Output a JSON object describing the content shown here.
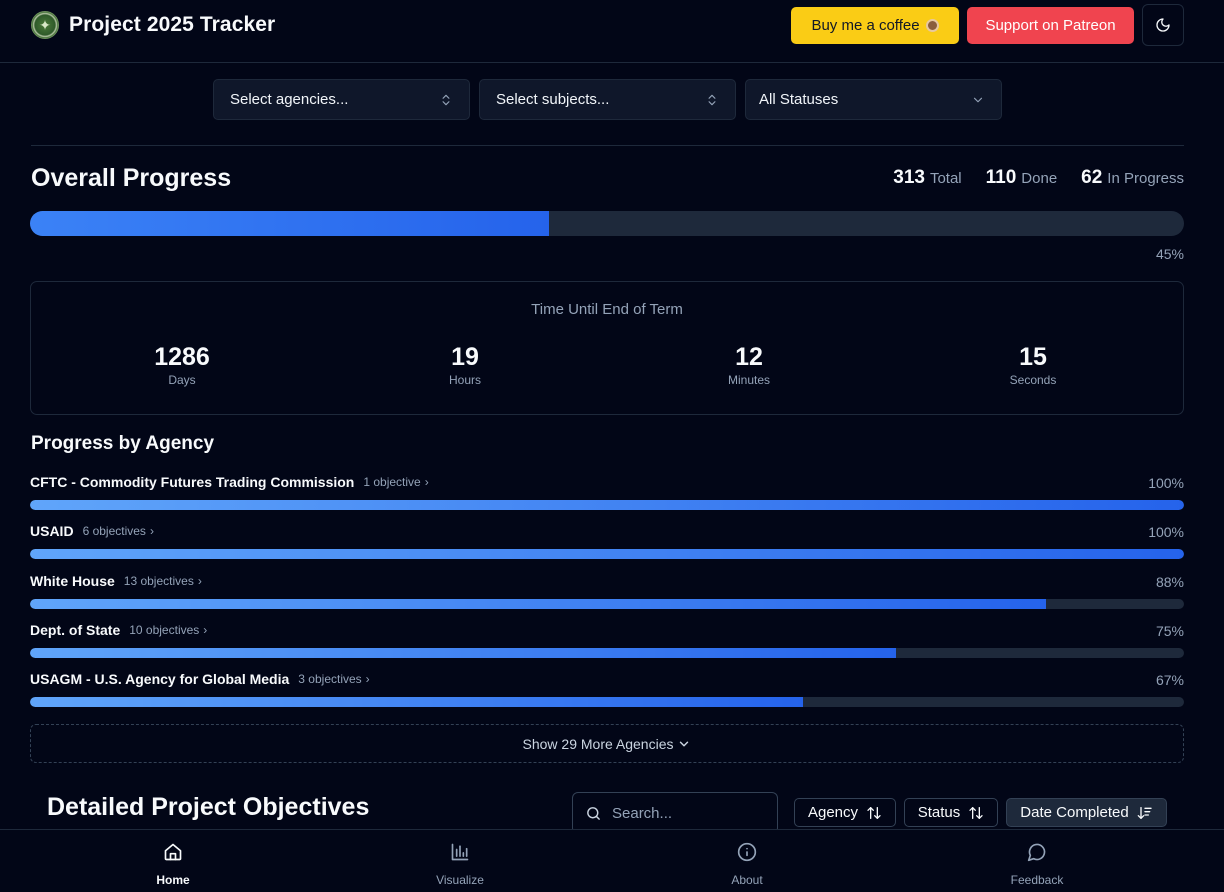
{
  "header": {
    "title": "Project 2025 Tracker",
    "coffee_label": "Buy me a coffee",
    "patreon_label": "Support on Patreon",
    "theme_icon": "moon-icon"
  },
  "filters": {
    "agencies_placeholder": "Select agencies...",
    "subjects_placeholder": "Select subjects...",
    "status_value": "All Statuses"
  },
  "overall": {
    "title": "Overall Progress",
    "total_num": "313",
    "total_label": "Total",
    "done_num": "110",
    "done_label": "Done",
    "progress_num": "62",
    "progress_label": "In Progress",
    "percent": 45,
    "percent_label": "45%"
  },
  "countdown": {
    "title": "Time Until End of Term",
    "units": [
      {
        "value": "1286",
        "label": "Days"
      },
      {
        "value": "19",
        "label": "Hours"
      },
      {
        "value": "12",
        "label": "Minutes"
      },
      {
        "value": "15",
        "label": "Seconds"
      }
    ]
  },
  "agencies": {
    "title": "Progress by Agency",
    "items": [
      {
        "name": "CFTC - Commodity Futures Trading Commission",
        "count": "1 objective",
        "percent": 100,
        "percent_label": "100%"
      },
      {
        "name": "USAID",
        "count": "6 objectives",
        "percent": 100,
        "percent_label": "100%"
      },
      {
        "name": "White House",
        "count": "13 objectives",
        "percent": 88,
        "percent_label": "88%"
      },
      {
        "name": "Dept. of State",
        "count": "10 objectives",
        "percent": 75,
        "percent_label": "75%"
      },
      {
        "name": "USAGM - U.S. Agency for Global Media",
        "count": "3 objectives",
        "percent": 67,
        "percent_label": "67%"
      }
    ],
    "show_more_label": "Show 29 More Agencies"
  },
  "objectives": {
    "title": "Detailed Project Objectives",
    "search_placeholder": "Search...",
    "sort_agency": "Agency",
    "sort_status": "Status",
    "sort_date": "Date Completed"
  },
  "nav": {
    "items": [
      {
        "label": "Home",
        "icon": "home-icon"
      },
      {
        "label": "Visualize",
        "icon": "bar-chart-icon"
      },
      {
        "label": "About",
        "icon": "info-icon"
      },
      {
        "label": "Feedback",
        "icon": "chat-bubble-icon"
      }
    ]
  },
  "colors": {
    "background": "#020617",
    "accent": "#2563eb",
    "coffee": "#facc15",
    "patreon": "#f0444f"
  }
}
